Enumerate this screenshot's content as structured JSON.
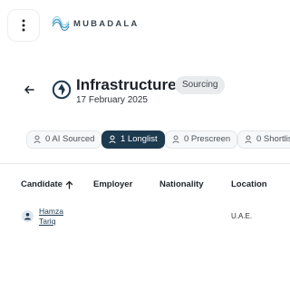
{
  "header": {
    "logo_text": "MUBADALA",
    "icons": {
      "menu": "kebab-menu-icon",
      "logo": "mubadala-logo-icon"
    }
  },
  "project": {
    "title": "Infrastructure",
    "status": "Sourcing",
    "date": "17 February 2025",
    "icons": {
      "back": "arrow-left-icon",
      "project": "project-icon"
    }
  },
  "tabs": [
    {
      "label": "0 AI Sourced",
      "icon": "person-search-icon",
      "active": false
    },
    {
      "label": "1 Longlist",
      "icon": "person-search-icon",
      "active": true
    },
    {
      "label": "0 Prescreen",
      "icon": "person-search-icon",
      "active": false
    },
    {
      "label": "0 Shortlis",
      "icon": "person-search-icon",
      "active": false
    }
  ],
  "table": {
    "columns": [
      {
        "label": "Candidate",
        "sort": "asc"
      },
      {
        "label": "Employer"
      },
      {
        "label": "Nationality"
      },
      {
        "label": "Location"
      }
    ],
    "rows": [
      {
        "candidate": "Hamza Tariq",
        "employer": "",
        "nationality": "",
        "location": "U.A.E."
      }
    ]
  },
  "colors": {
    "accent": "#1d3a4f",
    "badge": "#e9ebed"
  }
}
